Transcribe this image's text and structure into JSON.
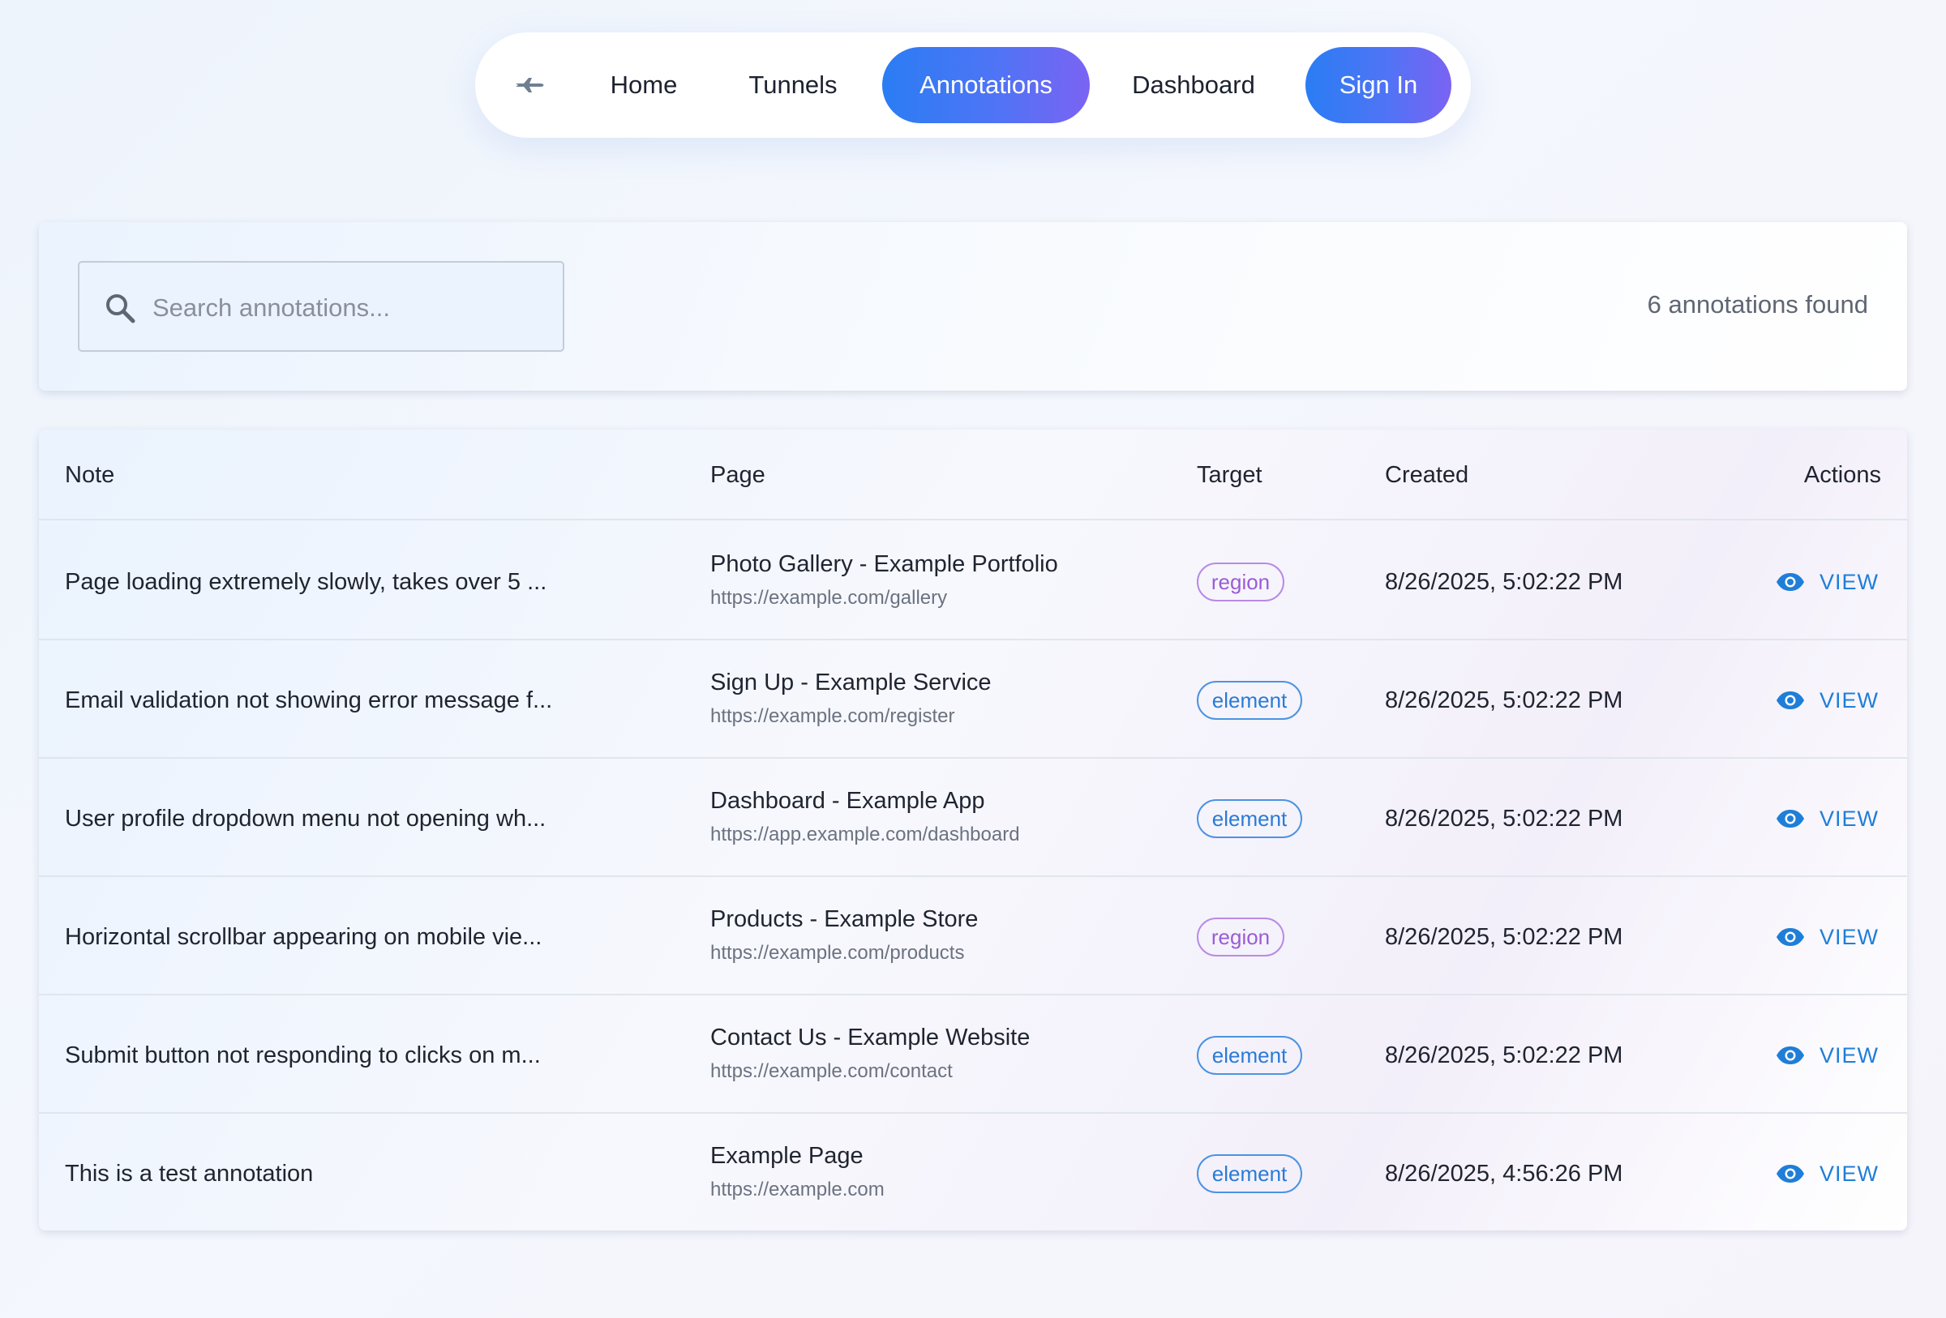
{
  "nav": {
    "logo_icon": "plane-icon",
    "links": [
      {
        "label": "Home",
        "active": false
      },
      {
        "label": "Tunnels",
        "active": false
      },
      {
        "label": "Annotations",
        "active": true
      },
      {
        "label": "Dashboard",
        "active": false
      }
    ],
    "signin_label": "Sign In"
  },
  "search": {
    "placeholder": "Search annotations...",
    "value": "",
    "result_count": "6 annotations found"
  },
  "table": {
    "headers": {
      "note": "Note",
      "page": "Page",
      "target": "Target",
      "created": "Created",
      "actions": "Actions"
    },
    "rows": [
      {
        "note": "Page loading extremely slowly, takes over 5 ...",
        "page_title": "Photo Gallery - Example Portfolio",
        "page_url": "https://example.com/gallery",
        "target": "region",
        "created": "8/26/2025, 5:02:22 PM",
        "action": "VIEW"
      },
      {
        "note": "Email validation not showing error message f...",
        "page_title": "Sign Up - Example Service",
        "page_url": "https://example.com/register",
        "target": "element",
        "created": "8/26/2025, 5:02:22 PM",
        "action": "VIEW"
      },
      {
        "note": "User profile dropdown menu not opening wh...",
        "page_title": "Dashboard - Example App",
        "page_url": "https://app.example.com/dashboard",
        "target": "element",
        "created": "8/26/2025, 5:02:22 PM",
        "action": "VIEW"
      },
      {
        "note": "Horizontal scrollbar appearing on mobile vie...",
        "page_title": "Products - Example Store",
        "page_url": "https://example.com/products",
        "target": "region",
        "created": "8/26/2025, 5:02:22 PM",
        "action": "VIEW"
      },
      {
        "note": "Submit button not responding to clicks on m...",
        "page_title": "Contact Us - Example Website",
        "page_url": "https://example.com/contact",
        "target": "element",
        "created": "8/26/2025, 5:02:22 PM",
        "action": "VIEW"
      },
      {
        "note": "This is a test annotation",
        "page_title": "Example Page",
        "page_url": "https://example.com",
        "target": "element",
        "created": "8/26/2025, 4:56:26 PM",
        "action": "VIEW"
      }
    ]
  },
  "colors": {
    "accent_start": "#2a7df4",
    "accent_end": "#7b63f3",
    "link_blue": "#1f7ed8",
    "region_chip": "#9b5cd6",
    "element_chip": "#2a7bd6"
  }
}
